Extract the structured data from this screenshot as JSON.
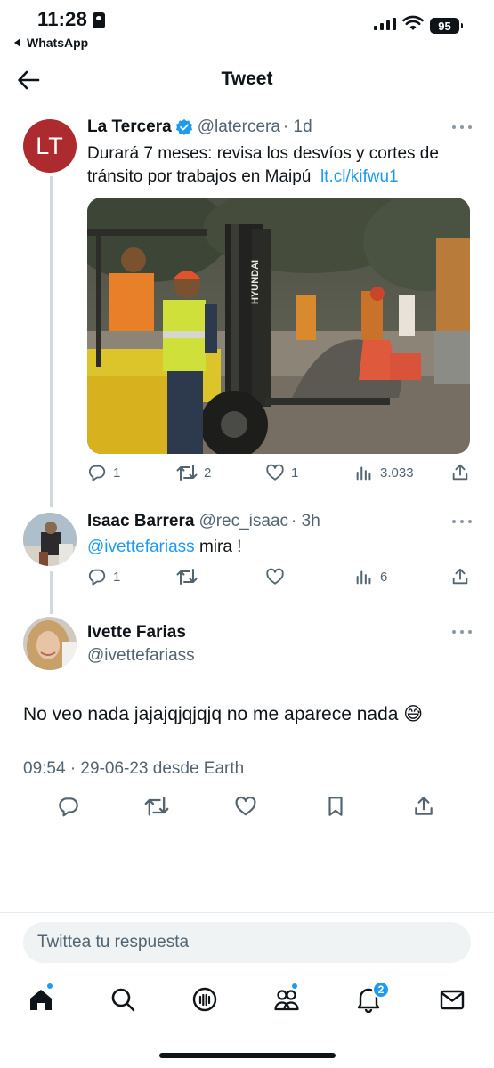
{
  "status_bar": {
    "time": "11:28",
    "back_app": "WhatsApp",
    "battery": "95"
  },
  "header": {
    "title": "Tweet"
  },
  "tweets": [
    {
      "avatar_initials": "LT",
      "name": "La Tercera",
      "handle": "@latercera",
      "time": "· 1d",
      "text": "Durará 7 meses: revisa los desvíos y cortes de tránsito por trabajos en Maipú",
      "link": "lt.cl/kifwu1",
      "media_brand": "HYUNDAI",
      "stats": {
        "replies": "1",
        "retweets": "2",
        "likes": "1",
        "views": "3.033"
      }
    },
    {
      "name": "Isaac Barrera",
      "handle": "@rec_isaac",
      "time": "· 3h",
      "mention": "@ivettefariass",
      "text": " mira !",
      "stats": {
        "replies": "1",
        "retweets": "",
        "likes": "",
        "views": "6"
      }
    }
  ],
  "focus_tweet": {
    "name": "Ivette Farias",
    "handle": "@ivettefariass",
    "text": "No veo nada jajajqjqjqjq no me aparece nada 😅",
    "timestamp": "09:54 · 29-06-23 desde Earth"
  },
  "reply_box": {
    "placeholder": "Twittea tu respuesta"
  },
  "tabbar": {
    "notifications_count": "2"
  },
  "colors": {
    "accent": "#1d9bf0",
    "avatar_lt": "#ad2b2f",
    "muted": "#536471"
  }
}
